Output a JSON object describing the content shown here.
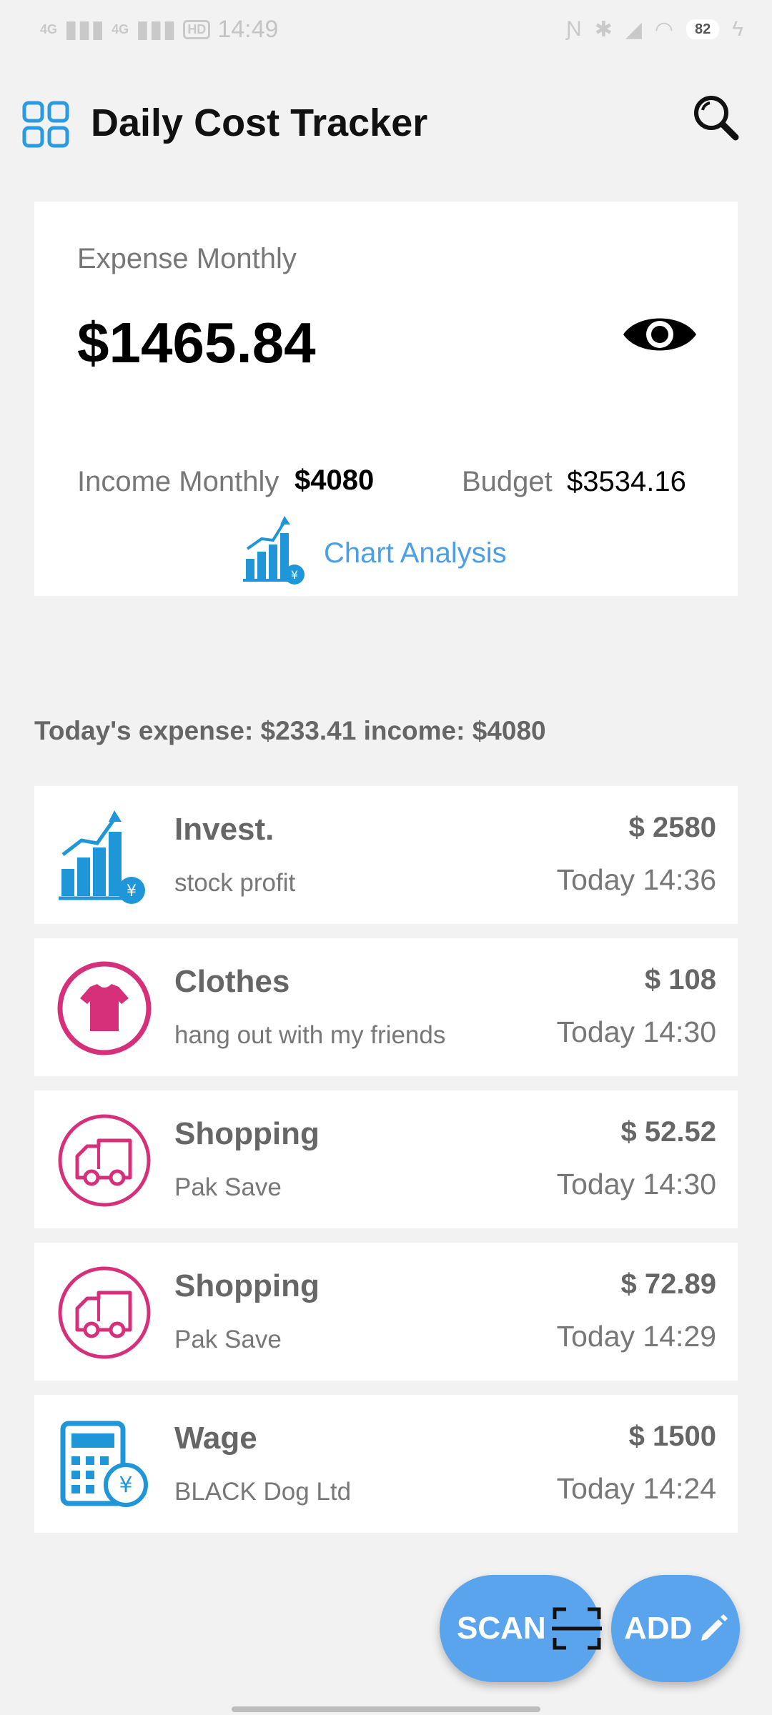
{
  "status_bar": {
    "net1": "4G",
    "net2": "4G",
    "hd": "HD",
    "time": "14:49",
    "battery": "82"
  },
  "header": {
    "title": "Daily Cost Tracker",
    "menu_icon": "grid-icon",
    "search_icon": "search-icon"
  },
  "summary": {
    "expense_label": "Expense Monthly",
    "expense_value": "$1465.84",
    "income_label": "Income Monthly",
    "income_value": "$4080",
    "budget_label": "Budget",
    "budget_value": "$3534.16",
    "chart_link": "Chart Analysis"
  },
  "today": {
    "text": "Today's expense: $233.41 income: $4080"
  },
  "transactions": [
    {
      "category": "Invest.",
      "note": "stock profit",
      "amount": "$ 2580",
      "time": "Today 14:36",
      "icon": "invest-icon"
    },
    {
      "category": "Clothes",
      "note": "hang out with my friends",
      "amount": "$ 108",
      "time": "Today 14:30",
      "icon": "clothes-icon"
    },
    {
      "category": "Shopping",
      "note": "Pak Save",
      "amount": "$ 52.52",
      "time": "Today 14:30",
      "icon": "shopping-cart-icon"
    },
    {
      "category": "Shopping",
      "note": "Pak Save",
      "amount": "$ 72.89",
      "time": "Today 14:29",
      "icon": "shopping-cart-icon"
    },
    {
      "category": "Wage",
      "note": "BLACK Dog Ltd",
      "amount": "$ 1500",
      "time": "Today 14:24",
      "icon": "wage-calculator-icon"
    }
  ],
  "actions": {
    "scan_label": "SCAN",
    "add_label": "ADD"
  },
  "colors": {
    "accent": "#5aa4ee",
    "link": "#4a9fe8",
    "invest": "#1e96d8",
    "clothes": "#d6307a"
  }
}
